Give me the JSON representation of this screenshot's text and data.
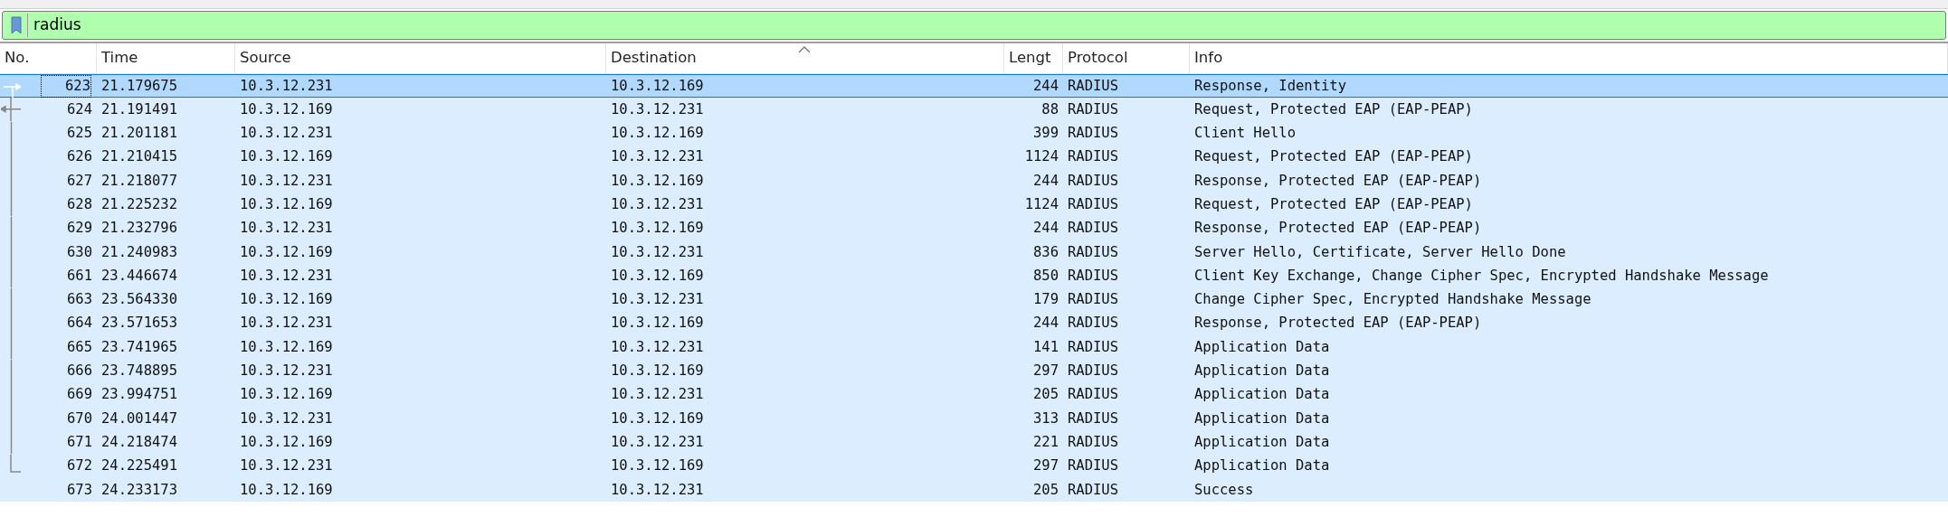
{
  "filter": {
    "value": "radius"
  },
  "table": {
    "columns": [
      {
        "label": "No."
      },
      {
        "label": "Time"
      },
      {
        "label": "Source"
      },
      {
        "label": "Destination",
        "sorted": true
      },
      {
        "label": "Lengt"
      },
      {
        "label": "Protocol"
      },
      {
        "label": "Info"
      }
    ],
    "rows": [
      {
        "cells": [
          "623",
          "21.179675",
          "10.3.12.231",
          "10.3.12.169",
          "244",
          "RADIUS",
          "Response, Identity"
        ],
        "selected": true,
        "kind": "start"
      },
      {
        "cells": [
          "624",
          "21.191491",
          "10.3.12.169",
          "10.3.12.231",
          "88",
          "RADIUS",
          "Request, Protected EAP (EAP-PEAP)"
        ],
        "selected": false,
        "kind": "response"
      },
      {
        "cells": [
          "625",
          "21.201181",
          "10.3.12.231",
          "10.3.12.169",
          "399",
          "RADIUS",
          "Client Hello"
        ],
        "selected": false,
        "kind": "member"
      },
      {
        "cells": [
          "626",
          "21.210415",
          "10.3.12.169",
          "10.3.12.231",
          "1124",
          "RADIUS",
          "Request, Protected EAP (EAP-PEAP)"
        ],
        "selected": false,
        "kind": "member"
      },
      {
        "cells": [
          "627",
          "21.218077",
          "10.3.12.231",
          "10.3.12.169",
          "244",
          "RADIUS",
          "Response, Protected EAP (EAP-PEAP)"
        ],
        "selected": false,
        "kind": "member"
      },
      {
        "cells": [
          "628",
          "21.225232",
          "10.3.12.169",
          "10.3.12.231",
          "1124",
          "RADIUS",
          "Request, Protected EAP (EAP-PEAP)"
        ],
        "selected": false,
        "kind": "member"
      },
      {
        "cells": [
          "629",
          "21.232796",
          "10.3.12.231",
          "10.3.12.169",
          "244",
          "RADIUS",
          "Response, Protected EAP (EAP-PEAP)"
        ],
        "selected": false,
        "kind": "member"
      },
      {
        "cells": [
          "630",
          "21.240983",
          "10.3.12.169",
          "10.3.12.231",
          "836",
          "RADIUS",
          "Server Hello, Certificate, Server Hello Done"
        ],
        "selected": false,
        "kind": "member"
      },
      {
        "cells": [
          "661",
          "23.446674",
          "10.3.12.231",
          "10.3.12.169",
          "850",
          "RADIUS",
          "Client Key Exchange, Change Cipher Spec, Encrypted Handshake Message"
        ],
        "selected": false,
        "kind": "member"
      },
      {
        "cells": [
          "663",
          "23.564330",
          "10.3.12.169",
          "10.3.12.231",
          "179",
          "RADIUS",
          "Change Cipher Spec, Encrypted Handshake Message"
        ],
        "selected": false,
        "kind": "member"
      },
      {
        "cells": [
          "664",
          "23.571653",
          "10.3.12.231",
          "10.3.12.169",
          "244",
          "RADIUS",
          "Response, Protected EAP (EAP-PEAP)"
        ],
        "selected": false,
        "kind": "member"
      },
      {
        "cells": [
          "665",
          "23.741965",
          "10.3.12.169",
          "10.3.12.231",
          "141",
          "RADIUS",
          "Application Data"
        ],
        "selected": false,
        "kind": "member"
      },
      {
        "cells": [
          "666",
          "23.748895",
          "10.3.12.231",
          "10.3.12.169",
          "297",
          "RADIUS",
          "Application Data"
        ],
        "selected": false,
        "kind": "member"
      },
      {
        "cells": [
          "669",
          "23.994751",
          "10.3.12.169",
          "10.3.12.231",
          "205",
          "RADIUS",
          "Application Data"
        ],
        "selected": false,
        "kind": "member"
      },
      {
        "cells": [
          "670",
          "24.001447",
          "10.3.12.231",
          "10.3.12.169",
          "313",
          "RADIUS",
          "Application Data"
        ],
        "selected": false,
        "kind": "member"
      },
      {
        "cells": [
          "671",
          "24.218474",
          "10.3.12.169",
          "10.3.12.231",
          "221",
          "RADIUS",
          "Application Data"
        ],
        "selected": false,
        "kind": "member"
      },
      {
        "cells": [
          "672",
          "24.225491",
          "10.3.12.231",
          "10.3.12.169",
          "297",
          "RADIUS",
          "Application Data"
        ],
        "selected": false,
        "kind": "end"
      },
      {
        "cells": [
          "673",
          "24.233173",
          "10.3.12.169",
          "10.3.12.231",
          "205",
          "RADIUS",
          "Success"
        ],
        "selected": false,
        "kind": "plain"
      }
    ]
  }
}
